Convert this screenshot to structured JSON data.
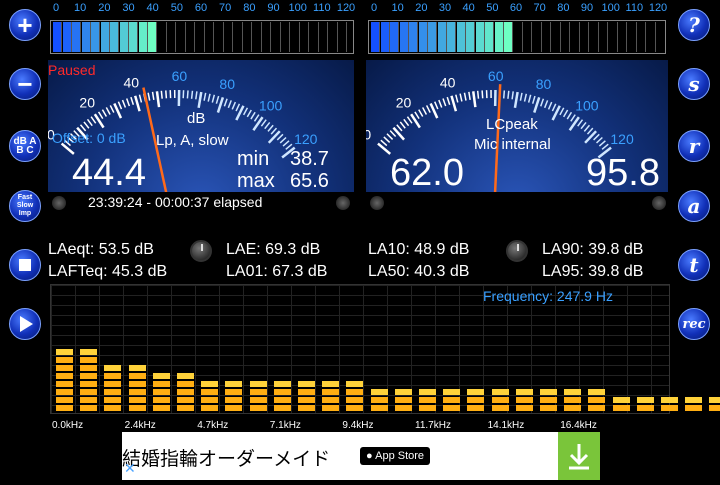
{
  "side_left": [
    {
      "name": "plus-button",
      "label": "+"
    },
    {
      "name": "minus-button",
      "label": "−"
    },
    {
      "name": "dbabc-button",
      "label": "dB A B C"
    },
    {
      "name": "fast-slow-imp-button",
      "label": "Fast Slow Imp"
    },
    {
      "name": "stop-button",
      "label": "■"
    },
    {
      "name": "play-button",
      "label": "▶"
    }
  ],
  "side_right": [
    {
      "name": "help-button",
      "label": "?"
    },
    {
      "name": "s-button",
      "label": "s"
    },
    {
      "name": "r-button",
      "label": "r"
    },
    {
      "name": "a-button",
      "label": "a"
    },
    {
      "name": "t-button",
      "label": "t"
    },
    {
      "name": "rec-button",
      "label": "rec"
    }
  ],
  "level_scale": [
    "0",
    "10",
    "20",
    "30",
    "40",
    "50",
    "60",
    "70",
    "80",
    "90",
    "100",
    "110",
    "120"
  ],
  "level_left": {
    "fill_fraction": 0.36
  },
  "level_right": {
    "fill_fraction": 0.49
  },
  "meter_left": {
    "status": "Paused",
    "dial_labels": [
      "0",
      "20",
      "40",
      "60",
      "80",
      "100",
      "120"
    ],
    "unit": "dB",
    "weighting": "Lp, A, slow",
    "offset": "Offset: 0 dB",
    "value": "44.4",
    "min_label": "min",
    "min_value": "38.7",
    "max_label": "max",
    "max_value": "65.6",
    "needle_db": 44.4
  },
  "meter_right": {
    "dial_labels": [
      "0",
      "20",
      "40",
      "60",
      "80",
      "100",
      "120"
    ],
    "mode": "LCpeak",
    "source": "Mic internal",
    "value": "62.0",
    "peak": "95.8",
    "needle_db": 62
  },
  "elapsed": "23:39:24 - 00:00:37 elapsed",
  "stats": {
    "laeqt": "LAeqt: 53.5 dB",
    "lafteq": "LAFTeq: 45.3 dB",
    "lae": "LAE: 69.3 dB",
    "la01": "LA01: 67.3 dB",
    "la10": "LA10: 48.9 dB",
    "la50": "LA50: 40.3 dB",
    "la90": "LA90: 39.8 dB",
    "la95": "LA95: 39.8 dB"
  },
  "frequency": "Frequency: 247.9 Hz",
  "spectrum": {
    "levels": [
      0.52,
      0.47,
      0.4,
      0.37,
      0.34,
      0.3,
      0.27,
      0.28,
      0.26,
      0.25,
      0.23,
      0.23,
      0.22,
      0.21,
      0.2,
      0.19,
      0.19,
      0.18,
      0.18,
      0.17,
      0.17,
      0.17,
      0.16,
      0.15,
      0.13,
      0.12,
      0.11,
      0.1,
      0.09
    ],
    "freq_labels": [
      "0.0kHz",
      "2.4kHz",
      "4.7kHz",
      "7.1kHz",
      "9.4kHz",
      "11.7kHz",
      "14.1kHz",
      "16.4kHz"
    ]
  },
  "ad": {
    "text": "結婚指輪オーダーメイド",
    "store": "App Store",
    "close": "✕"
  },
  "colors": {
    "accent": "#3aa0ff",
    "needle": "#ff6a1a",
    "status": "#ff2a2a"
  }
}
